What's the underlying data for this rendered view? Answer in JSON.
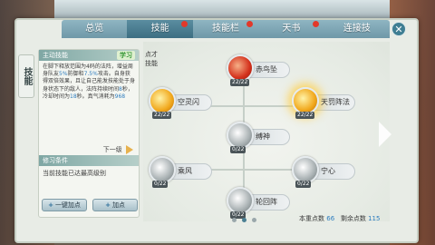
{
  "tabs": [
    {
      "label": "总览",
      "active": false,
      "badge": false
    },
    {
      "label": "技能",
      "active": true,
      "badge": true
    },
    {
      "label": "技能栏",
      "active": false,
      "badge": true
    },
    {
      "label": "天书",
      "active": false,
      "badge": true
    },
    {
      "label": "连接技",
      "active": false,
      "badge": false
    }
  ],
  "close_icon": "close-icon",
  "side_tab": "技能",
  "left": {
    "skill_title": "主动技能",
    "skill_state": "学习",
    "desc_parts": [
      {
        "text": "在脚下释放范围为4码的法阵，增益周身队友",
        "hl": false
      },
      {
        "text": "5%",
        "hl": true
      },
      {
        "text": "防御和",
        "hl": false
      },
      {
        "text": "7.5%",
        "hl": true
      },
      {
        "text": "攻击。自身获得双倍效果，且让自己能发技能处于身身状态下的敌人，法阵持续时间",
        "hl": false
      },
      {
        "text": "8",
        "hl": true
      },
      {
        "text": "秒，冷却时间为",
        "hl": false
      },
      {
        "text": "18",
        "hl": true
      },
      {
        "text": "秒。真气消耗为",
        "hl": false
      },
      {
        "text": "968",
        "hl": true
      }
    ],
    "next_level": "下一级",
    "req_title": "修习条件",
    "req_text": "当前技能已达最高级别",
    "btn_add_all": "一键加点",
    "btn_add": "加点"
  },
  "labels": {
    "point_label": "点才",
    "skill_label": "技能"
  },
  "skills": [
    {
      "name": "赤鸟坠",
      "level": "22/22",
      "color": "red"
    },
    {
      "name": "空灵闪",
      "level": "22/22",
      "color": "gold"
    },
    {
      "name": "天罚阵法",
      "level": "22/22",
      "color": "gold"
    },
    {
      "name": "缚神",
      "level": "0/22",
      "color": "gray"
    },
    {
      "name": "乘风",
      "level": "0/22",
      "color": "gray"
    },
    {
      "name": "宁心",
      "level": "0/22",
      "color": "gray"
    },
    {
      "name": "轮回阵",
      "level": "0/22",
      "color": "gray"
    }
  ],
  "points": {
    "current_label": "本重点数",
    "current_value": "66",
    "remain_label": "剩余点数",
    "remain_value": "115"
  },
  "colors": {
    "accent": "#3d6e82",
    "highlight": "#2e7dbf",
    "badge": "#e2382a"
  }
}
